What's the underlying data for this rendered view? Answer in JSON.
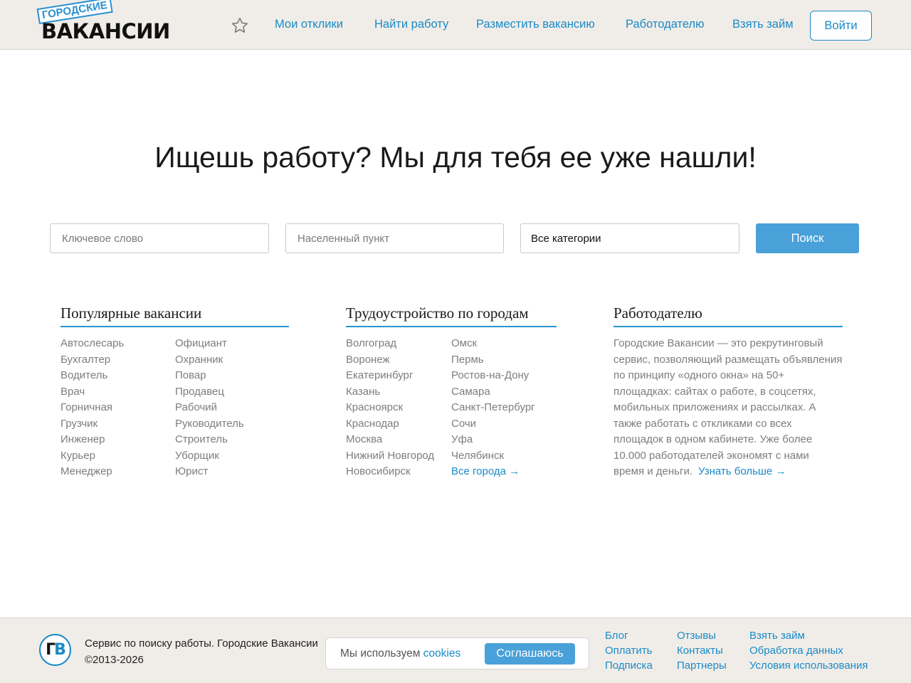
{
  "header": {
    "logo_small": "ГОРОДСКИЕ",
    "logo_big": "ВАКАНСИИ",
    "favorites_icon": "star-icon",
    "nav": [
      "Мои отклики",
      "Найти работу",
      "Разместить вакансию",
      "Работодателю",
      "Взять займ"
    ],
    "login_label": "Войти"
  },
  "hero": {
    "title": "Ищешь работу? Мы для тебя ее уже нашли!"
  },
  "search": {
    "keyword_placeholder": "Ключевое слово",
    "location_placeholder": "Населенный пункт",
    "category_value": "Все категории",
    "button_label": "Поиск"
  },
  "popular": {
    "title": "Популярные вакансии",
    "col1": [
      "Автослесарь",
      "Бухгалтер",
      "Водитель",
      "Врач",
      "Горничная",
      "Грузчик",
      "Инженер",
      "Курьер",
      "Менеджер"
    ],
    "col2": [
      "Официант",
      "Охранник",
      "Повар",
      "Продавец",
      "Рабочий",
      "Руководитель",
      "Строитель",
      "Уборщик",
      "Юрист"
    ]
  },
  "cities": {
    "title": "Трудоустройство по городам",
    "col1": [
      "Волгоград",
      "Воронеж",
      "Екатеринбург",
      "Казань",
      "Красноярск",
      "Краснодар",
      "Москва",
      "Нижний Новгород",
      "Новосибирск"
    ],
    "col2": [
      "Омск",
      "Пермь",
      "Ростов-на-Дону",
      "Самара",
      "Санкт-Петербург",
      "Сочи",
      "Уфа",
      "Челябинск"
    ],
    "all_cities": "Все города →"
  },
  "employer": {
    "title": "Работодателю",
    "text": "Городские Вакансии — это рекрутинговый сервис, позволяющий размещать объявления по принципу «одного окна» на 50+ площадках: сайтах о работе, в соцсетях, мобильных приложениях и рассылках. А также работать с откликами со всех площадок в одном кабинете. Уже более 10.000 работодателей экономят с нами время и деньги.",
    "more": "Узнать больше →"
  },
  "footer": {
    "logo_letters": [
      "Г",
      "В"
    ],
    "line1": "Сервис по поиску работы. Городские Вакансии",
    "line2": "©2013-2026",
    "cookie_text": "Мы используем ",
    "cookie_link": "cookies",
    "cookie_btn": "Соглашаюсь",
    "col1": [
      "Блог",
      "Оплатить",
      "Подписка"
    ],
    "col2": [
      "Отзывы",
      "Контакты",
      "Партнеры"
    ],
    "col3": [
      "Взять займ",
      "Обработка данных",
      "Условия использования"
    ]
  },
  "colors": {
    "accent": "#1a8ac7",
    "button": "#4aa0d8",
    "header_bg": "#f0ede8",
    "muted_text": "#7d7d7d"
  }
}
